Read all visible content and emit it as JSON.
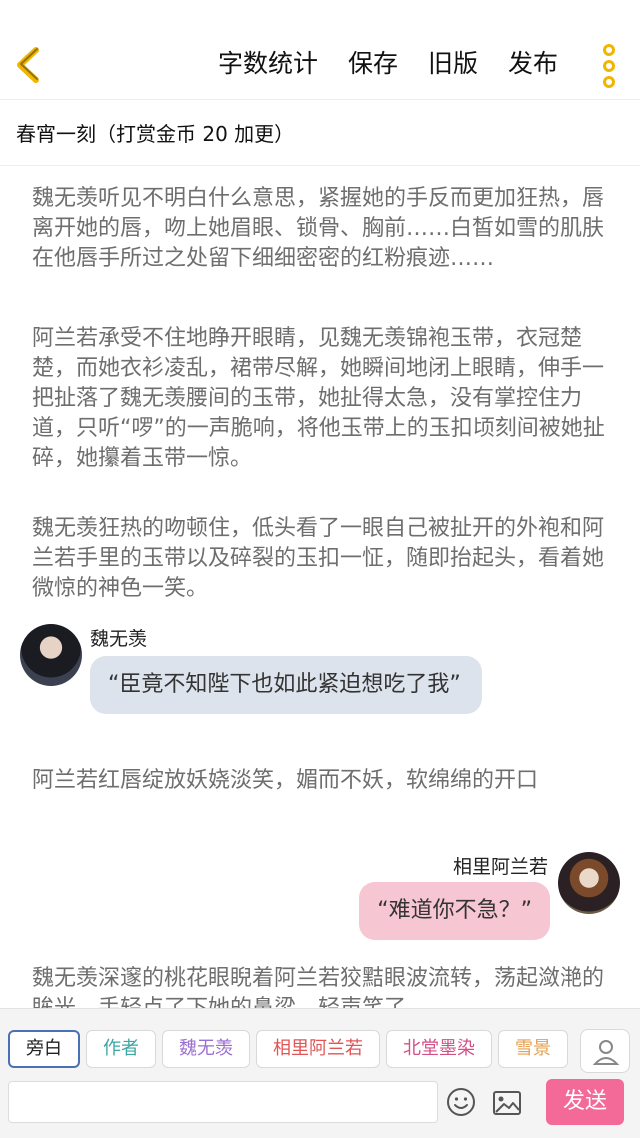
{
  "header": {
    "actions": [
      "字数统计",
      "保存",
      "旧版",
      "发布"
    ]
  },
  "chapter": {
    "title": "春宵一刻（打赏金币 20 加更）"
  },
  "content": {
    "narration_1": "魏无羡听见不明白什么意思，紧握她的手反而更加狂热，唇离开她的唇，吻上她眉眼、锁骨、胸前……白皙如雪的肌肤在他唇手所过之处留下细细密密的红粉痕迹……",
    "narration_2": "阿兰若承受不住地睁开眼睛，见魏无羡锦袍玉带，衣冠楚楚，而她衣衫凌乱，裙带尽解，她瞬间地闭上眼睛，伸手一把扯落了魏无羡腰间的玉带，她扯得太急，没有掌控住力道，只听“啰”的一声脆响，将他玉带上的玉扣顷刻间被她扯碎，她攥着玉带一惊。",
    "narration_3": "魏无羡狂热的吻顿住，低头看了一眼自己被扯开的外袍和阿兰若手里的玉带以及碎裂的玉扣一怔，随即抬起头，看着她微惊的神色一笑。",
    "dialog_1": {
      "speaker": "魏无羡",
      "text": "“臣竟不知陛下也如此紧迫想吃了我”"
    },
    "narration_4": "阿兰若红唇绽放妖娆淡笑，媚而不妖，软绵绵的开口",
    "dialog_2": {
      "speaker": "相里阿兰若",
      "text": "“难道你不急？”"
    },
    "narration_5": "魏无羡深邃的桃花眼睨着阿兰若狡黠眼波流转，荡起潋滟的眸光，手轻点了下她的鼻梁，轻声笑了"
  },
  "composer": {
    "roles": [
      {
        "label": "旁白",
        "color": "#222222"
      },
      {
        "label": "作者",
        "color": "#3aa7a3"
      },
      {
        "label": "魏无羡",
        "color": "#9b6fd1"
      },
      {
        "label": "相里阿兰若",
        "color": "#e05555"
      },
      {
        "label": "北堂墨染",
        "color": "#d34f86"
      },
      {
        "label": "雪景",
        "color": "#e6a04f"
      }
    ],
    "input_value": "",
    "send_label": "发送"
  },
  "colors": {
    "accent_yellow": "#f2b500",
    "send_pink": "#f36a98",
    "bubble_left": "#dde3ec",
    "bubble_right": "#f6c6d3"
  }
}
